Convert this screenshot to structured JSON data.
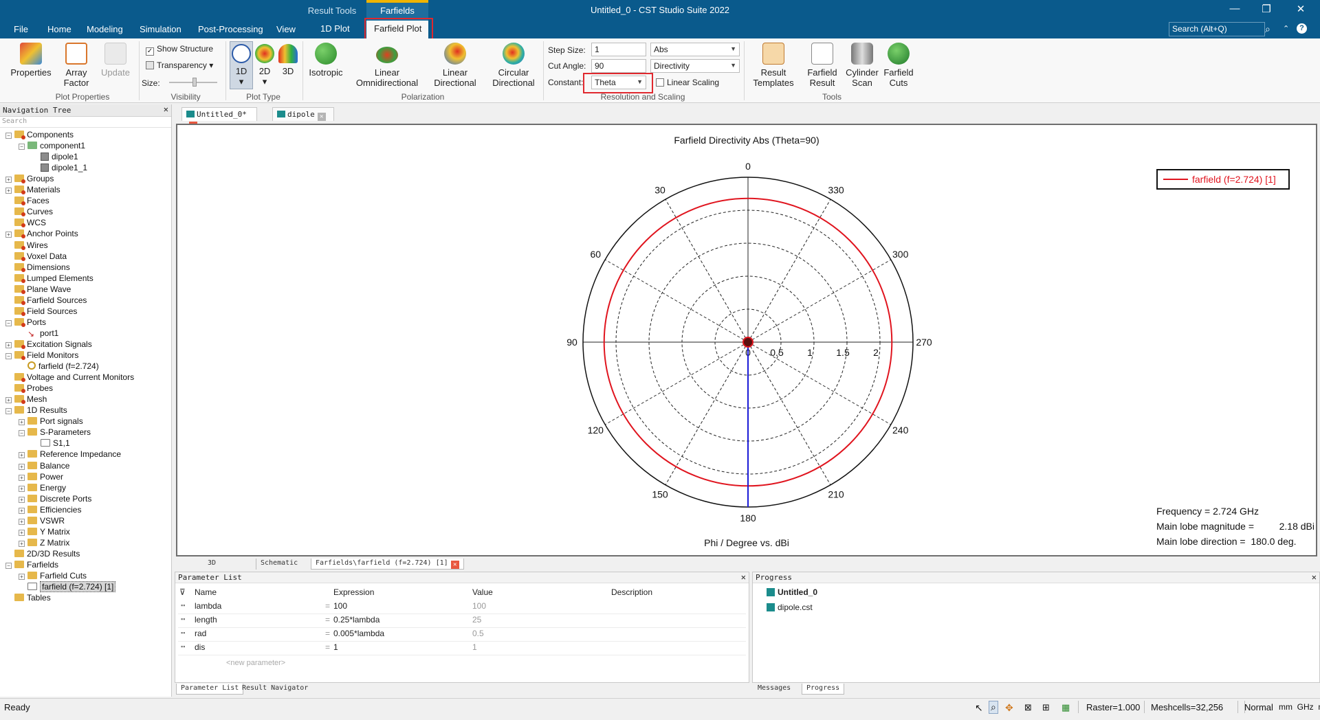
{
  "window": {
    "title": "Untitled_0 - CST Studio Suite 2022",
    "context_tabs": [
      "Result Tools",
      "Farfields"
    ],
    "controls": [
      "—",
      "❐",
      "✕"
    ]
  },
  "menu": {
    "tabs": [
      "File",
      "Home",
      "Modeling",
      "Simulation",
      "Post-Processing",
      "View"
    ],
    "subtabs": [
      "1D Plot",
      "Farfield Plot"
    ],
    "search_placeholder": "Search (Alt+Q)"
  },
  "ribbon": {
    "groups": {
      "plot_properties": "Plot Properties",
      "visibility": "Visibility",
      "plot_type": "Plot Type",
      "polarization": "Polarization",
      "resolution": "Resolution and Scaling",
      "tools": "Tools"
    },
    "buttons": {
      "properties": "Properties",
      "array_factor_1": "Array",
      "array_factor_2": "Factor",
      "update": "Update",
      "show_structure": "Show Structure",
      "transparency": "Transparency",
      "size": "Size:",
      "type_1d": "1D",
      "type_2d": "2D",
      "type_3d": "3D",
      "isotropic": "Isotropic",
      "linear_omni_1": "Linear",
      "linear_omni_2": "Omnidirectional",
      "linear_dir_1": "Linear",
      "linear_dir_2": "Directional",
      "circular_dir_1": "Circular",
      "circular_dir_2": "Directional",
      "result_templates_1": "Result",
      "result_templates_2": "Templates",
      "farfield_result_1": "Farfield",
      "farfield_result_2": "Result",
      "cylinder_scan_1": "Cylinder",
      "cylinder_scan_2": "Scan",
      "farfield_cuts_1": "Farfield",
      "farfield_cuts_2": "Cuts"
    },
    "fields": {
      "step_size_label": "Step Size:",
      "step_size_value": "1",
      "cut_angle_label": "Cut Angle:",
      "cut_angle_value": "90",
      "constant_label": "Constant:",
      "constant_value": "Theta",
      "abs_value": "Abs",
      "directivity_value": "Directivity",
      "linear_scaling": "Linear Scaling"
    }
  },
  "nav": {
    "title": "Navigation Tree",
    "search_placeholder": "Search",
    "items": [
      {
        "label": "Components",
        "level": 0,
        "icon": "folder-red",
        "exp": "−"
      },
      {
        "label": "component1",
        "level": 1,
        "icon": "folder-green",
        "exp": "−"
      },
      {
        "label": "dipole1",
        "level": 2,
        "icon": "cube",
        "exp": ""
      },
      {
        "label": "dipole1_1",
        "level": 2,
        "icon": "cube",
        "exp": ""
      },
      {
        "label": "Groups",
        "level": 0,
        "icon": "folder-red",
        "exp": "+"
      },
      {
        "label": "Materials",
        "level": 0,
        "icon": "folder-red",
        "exp": "+"
      },
      {
        "label": "Faces",
        "level": 0,
        "icon": "folder-red",
        "exp": ""
      },
      {
        "label": "Curves",
        "level": 0,
        "icon": "folder-red",
        "exp": ""
      },
      {
        "label": "WCS",
        "level": 0,
        "icon": "folder-red",
        "exp": ""
      },
      {
        "label": "Anchor Points",
        "level": 0,
        "icon": "folder-red",
        "exp": "+"
      },
      {
        "label": "Wires",
        "level": 0,
        "icon": "folder-red",
        "exp": ""
      },
      {
        "label": "Voxel Data",
        "level": 0,
        "icon": "folder-red",
        "exp": ""
      },
      {
        "label": "Dimensions",
        "level": 0,
        "icon": "folder-red",
        "exp": ""
      },
      {
        "label": "Lumped Elements",
        "level": 0,
        "icon": "folder-red",
        "exp": ""
      },
      {
        "label": "Plane Wave",
        "level": 0,
        "icon": "folder-red",
        "exp": ""
      },
      {
        "label": "Farfield Sources",
        "level": 0,
        "icon": "folder-red",
        "exp": ""
      },
      {
        "label": "Field Sources",
        "level": 0,
        "icon": "folder-red",
        "exp": ""
      },
      {
        "label": "Ports",
        "level": 0,
        "icon": "folder-red",
        "exp": "−"
      },
      {
        "label": "port1",
        "level": 1,
        "icon": "port",
        "exp": ""
      },
      {
        "label": "Excitation Signals",
        "level": 0,
        "icon": "folder-red",
        "exp": "+"
      },
      {
        "label": "Field Monitors",
        "level": 0,
        "icon": "folder-red",
        "exp": "−"
      },
      {
        "label": "farfield (f=2.724)",
        "level": 1,
        "icon": "monitor",
        "exp": ""
      },
      {
        "label": "Voltage and Current Monitors",
        "level": 0,
        "icon": "folder-red",
        "exp": ""
      },
      {
        "label": "Probes",
        "level": 0,
        "icon": "folder-red",
        "exp": ""
      },
      {
        "label": "Mesh",
        "level": 0,
        "icon": "folder-red",
        "exp": "+"
      },
      {
        "label": "1D Results",
        "level": 0,
        "icon": "folder",
        "exp": "−"
      },
      {
        "label": "Port signals",
        "level": 1,
        "icon": "folder",
        "exp": "+"
      },
      {
        "label": "S-Parameters",
        "level": 1,
        "icon": "folder",
        "exp": "−"
      },
      {
        "label": "S1,1",
        "level": 2,
        "icon": "curve",
        "exp": ""
      },
      {
        "label": "Reference Impedance",
        "level": 1,
        "icon": "folder",
        "exp": "+"
      },
      {
        "label": "Balance",
        "level": 1,
        "icon": "folder",
        "exp": "+"
      },
      {
        "label": "Power",
        "level": 1,
        "icon": "folder",
        "exp": "+"
      },
      {
        "label": "Energy",
        "level": 1,
        "icon": "folder",
        "exp": "+"
      },
      {
        "label": "Discrete Ports",
        "level": 1,
        "icon": "folder",
        "exp": "+"
      },
      {
        "label": "Efficiencies",
        "level": 1,
        "icon": "folder",
        "exp": "+"
      },
      {
        "label": "VSWR",
        "level": 1,
        "icon": "folder",
        "exp": "+"
      },
      {
        "label": "Y Matrix",
        "level": 1,
        "icon": "folder",
        "exp": "+"
      },
      {
        "label": "Z Matrix",
        "level": 1,
        "icon": "folder",
        "exp": "+"
      },
      {
        "label": "2D/3D Results",
        "level": 0,
        "icon": "folder",
        "exp": ""
      },
      {
        "label": "Farfields",
        "level": 0,
        "icon": "folder",
        "exp": "−"
      },
      {
        "label": "Farfield Cuts",
        "level": 1,
        "icon": "folder",
        "exp": "+"
      },
      {
        "label": "farfield (f=2.724) [1]",
        "level": 1,
        "icon": "curve",
        "exp": "",
        "selected": true
      },
      {
        "label": "Tables",
        "level": 0,
        "icon": "folder",
        "exp": ""
      }
    ]
  },
  "doc_tabs": [
    {
      "label": "Untitled_0*"
    },
    {
      "label": "dipole"
    }
  ],
  "plot": {
    "title": "Farfield Directivity Abs (Theta=90)",
    "xlabel": "Phi / Degree vs. dBi",
    "legend": "farfield (f=2.724) [1]",
    "info": {
      "freq_label": "Frequency =",
      "freq_value": "2.724 GHz",
      "mag_label": "Main lobe magnitude =",
      "mag_value": "2.18 dBi",
      "dir_label": "Main lobe direction =",
      "dir_value": "180.0 deg."
    }
  },
  "chart_data": {
    "type": "polar",
    "title": "Farfield Directivity Abs (Theta=90)",
    "xlabel": "Phi / Degree vs. dBi",
    "angle_labels": [
      "0",
      "330",
      "300",
      "270",
      "240",
      "210",
      "180",
      "150",
      "120",
      "90",
      "60",
      "30"
    ],
    "radial_labels": [
      "0",
      "0.5",
      "1",
      "1.5",
      "2"
    ],
    "radial_range": [
      0,
      2.5
    ],
    "series": [
      {
        "name": "farfield (f=2.724) [1]",
        "color": "#e0141e",
        "values_constant": 2.18
      }
    ],
    "main_lobe_direction": 180,
    "grid": true,
    "legend_position": "top-right"
  },
  "bottom_tabs": [
    "3D",
    "Schematic",
    "Farfields\\farfield (f=2.724) [1]"
  ],
  "param_list": {
    "title": "Parameter List",
    "columns": [
      "Name",
      "Expression",
      "Value",
      "Description"
    ],
    "rows": [
      {
        "name": "lambda",
        "expr": "100",
        "value": "100"
      },
      {
        "name": "length",
        "expr": "0.25*lambda",
        "value": "25"
      },
      {
        "name": "rad",
        "expr": "0.005*lambda",
        "value": "0.5"
      },
      {
        "name": "dis",
        "expr": "1",
        "value": "1"
      }
    ],
    "new_param": "<new parameter>",
    "tabs": [
      "Parameter List",
      "Result Navigator"
    ]
  },
  "progress": {
    "title": "Progress",
    "items": [
      "Untitled_0",
      "dipole.cst"
    ],
    "tabs": [
      "Messages",
      "Progress"
    ]
  },
  "status": {
    "ready": "Ready",
    "raster": "Raster=1.000",
    "meshcells": "Meshcells=32,256",
    "mode": "Normal",
    "units": "mm  GHz  ns  K"
  },
  "colors": {
    "titlebar": "#0a5a8c",
    "trace": "#e0141e",
    "lobe": "#1a1ad6",
    "highlight": "#e0282e"
  }
}
